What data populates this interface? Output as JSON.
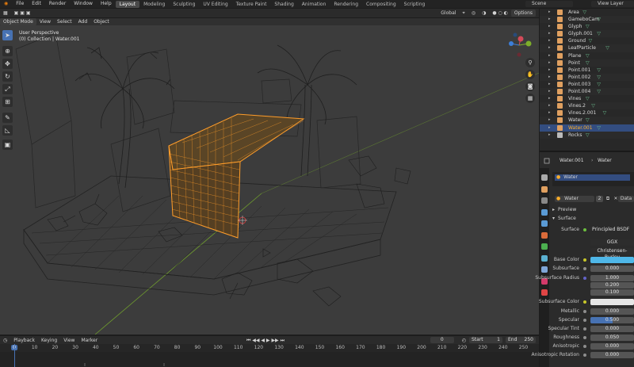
{
  "menu": {
    "items": [
      "File",
      "Edit",
      "Render",
      "Window",
      "Help"
    ],
    "workspaces": [
      "Layout",
      "Modeling",
      "Sculpting",
      "UV Editing",
      "Texture Paint",
      "Shading",
      "Animation",
      "Rendering",
      "Compositing",
      "Scripting"
    ],
    "active_workspace": "Layout",
    "scene": "Scene",
    "view_layer": "View Layer"
  },
  "viewport_header": {
    "mode": "Object Mode",
    "menus": [
      "View",
      "Select",
      "Add",
      "Object"
    ],
    "orientation": "Global",
    "options": "Options"
  },
  "viewport": {
    "perspective": "User Perspective",
    "collection": "(0) Collection | Water.001"
  },
  "outliner": {
    "rows": [
      {
        "name": "Area"
      },
      {
        "name": "GameboCam"
      },
      {
        "name": "Glyph"
      },
      {
        "name": "Glyph.001"
      },
      {
        "name": "Ground"
      },
      {
        "name": "LeafParticle"
      },
      {
        "name": "Plane"
      },
      {
        "name": "Point"
      },
      {
        "name": "Point.001"
      },
      {
        "name": "Point.002"
      },
      {
        "name": "Point.003"
      },
      {
        "name": "Point.004"
      },
      {
        "name": "Vines"
      },
      {
        "name": "Vines.2"
      },
      {
        "name": "Vines.2.001"
      },
      {
        "name": "Water"
      },
      {
        "name": "Water.001"
      },
      {
        "name": "Rocks"
      }
    ]
  },
  "properties": {
    "object_name": "Water.001",
    "material_name": "Water",
    "slot_name": "Water",
    "material_field": "Water",
    "users": "2",
    "data_label": "Data",
    "panel_preview": "Preview",
    "panel_surface": "Surface",
    "surface_label": "Surface",
    "surface_value": "Principled BSDF",
    "distribution": "GGX",
    "subsurface_method": "Christensen-Burley",
    "fields": {
      "base_color": "Base Color",
      "subsurface": "Subsurface",
      "subsurface_val": "0.000",
      "subsurface_radius": "Subsurface Radius",
      "radius_1": "1.000",
      "radius_2": "0.200",
      "radius_3": "0.100",
      "subsurface_color": "Subsurface Color",
      "metallic": "Metallic",
      "metallic_val": "0.000",
      "specular": "Specular",
      "specular_val": "0.500",
      "specular_tint": "Specular Tint",
      "specular_tint_val": "0.000",
      "roughness": "Roughness",
      "roughness_val": "0.050",
      "anisotropic": "Anisotropic",
      "anisotropic_val": "0.000",
      "anisotropic_rotation": "Anisotropic Rotation",
      "anisotropic_rotation_val": "0.000"
    },
    "colors": {
      "base_color": "#4fb7e8",
      "subsurface_color": "#e6e6e6",
      "specular_fill": "#4772b3"
    },
    "specular_fraction": 0.5
  },
  "timeline": {
    "menus": [
      "Playback",
      "Keying",
      "View",
      "Marker"
    ],
    "current_frame": "0",
    "start_label": "Start",
    "start": "1",
    "end_label": "End",
    "end": "250",
    "ticks": [
      "0",
      "10",
      "20",
      "30",
      "40",
      "50",
      "60",
      "70",
      "80",
      "90",
      "100",
      "110",
      "120",
      "130",
      "140",
      "150",
      "160",
      "170",
      "180",
      "190",
      "200",
      "210",
      "220",
      "230",
      "240",
      "250"
    ]
  },
  "colors": {
    "selection": "#ffa630",
    "accent": "#4772b3"
  }
}
